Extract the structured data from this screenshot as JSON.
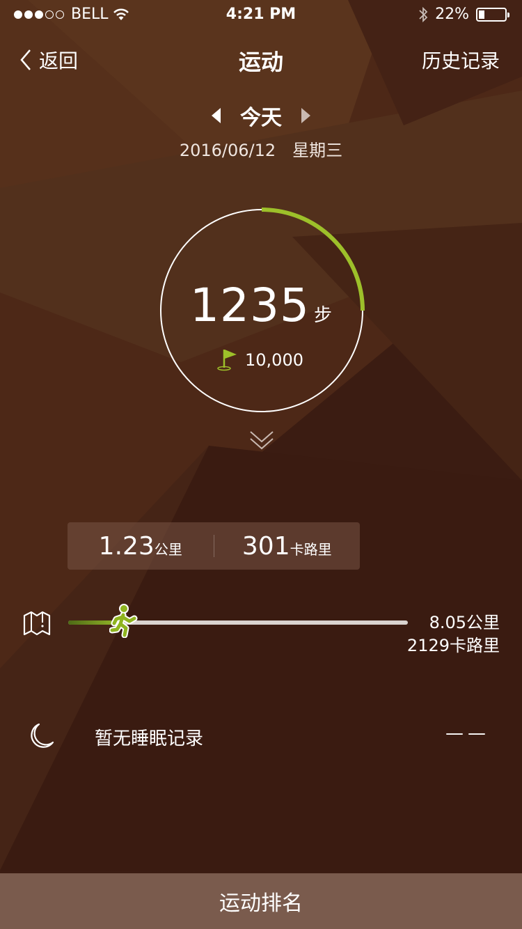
{
  "status_bar": {
    "carrier": "BELL",
    "time": "4:21 PM",
    "battery": "22%",
    "battery_level": 0.22,
    "signal_bars": 3,
    "signal_total": 5
  },
  "nav": {
    "back_label": "返回",
    "title": "运动",
    "history_label": "历史记录"
  },
  "date": {
    "label": "今天",
    "date": "2016/06/12",
    "weekday": "星期三"
  },
  "steps": {
    "count": "1235",
    "unit": "步",
    "goal": "10,000",
    "ring_progress": 0.25
  },
  "summary": {
    "distance_value": "1.23",
    "distance_unit": "公里",
    "calories_value": "301",
    "calories_unit": "卡路里"
  },
  "progress": {
    "fraction": 0.165,
    "total_distance": "8.05公里",
    "total_calories": "2129卡路里"
  },
  "sleep": {
    "text": "暂无睡眠记录",
    "value": "——"
  },
  "bottom": {
    "label": "运动排名"
  },
  "colors": {
    "accent": "#9dc02a",
    "background": "#3b1d12",
    "bottom_bar": "#7a5b4d"
  }
}
